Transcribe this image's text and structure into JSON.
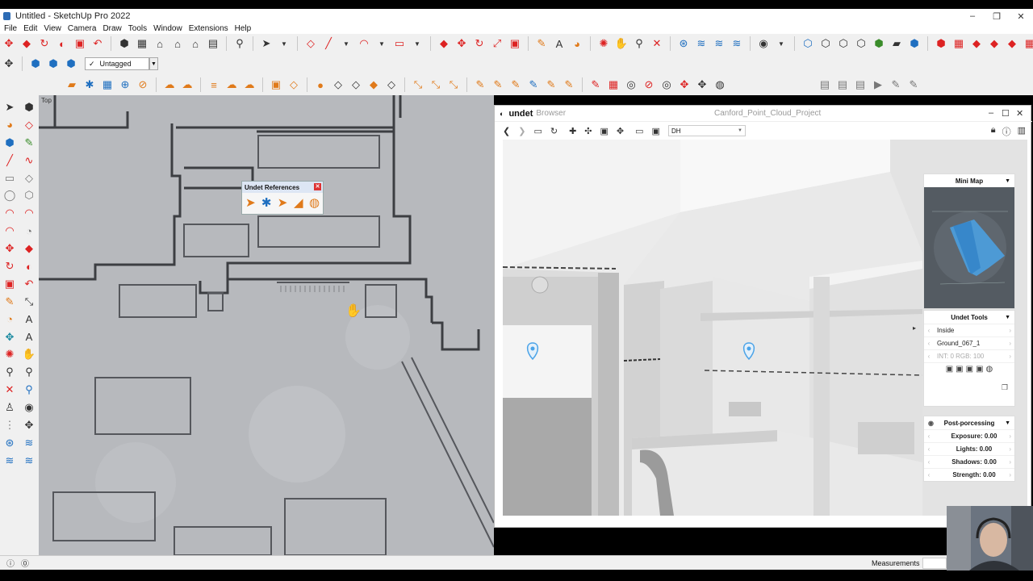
{
  "window": {
    "title": "Untitled - SketchUp Pro 2022",
    "controls": [
      "–",
      "❐",
      "✕"
    ]
  },
  "menu": [
    "File",
    "Edit",
    "View",
    "Camera",
    "Draw",
    "Tools",
    "Window",
    "Extensions",
    "Help"
  ],
  "tag_selector": {
    "check": "✓",
    "value": "Untagged"
  },
  "viewport": {
    "label": "Top"
  },
  "undet_references": {
    "title": "Undet References",
    "close": "✕"
  },
  "browser": {
    "logo": "undet",
    "subtitle": "Browser",
    "project": "Canford_Point_Cloud_Project",
    "scan_select": "DH",
    "window_controls": [
      "–",
      "☐",
      "✕"
    ],
    "mini_map": {
      "title": "Mini Map"
    },
    "undet_tools": {
      "title": "Undet Tools",
      "mode": "Inside",
      "scan": "Ground_067_1",
      "channels": "INT: 0 RGB: 100"
    },
    "post_processing": {
      "title": "Post-porcessing",
      "rows": [
        {
          "label": "Exposure: 0.00"
        },
        {
          "label": "Lights: 0.00"
        },
        {
          "label": "Shadows: 0.00"
        },
        {
          "label": "Strength: 0.00"
        }
      ]
    }
  },
  "status": {
    "measurements_label": "Measurements"
  },
  "colors": {
    "toolbar_bg": "#f0f0f0",
    "viewport_bg": "#b9bbbf",
    "accent_blue": "#1f6fc0",
    "pointcloud_blue": "#4aa3e8"
  }
}
